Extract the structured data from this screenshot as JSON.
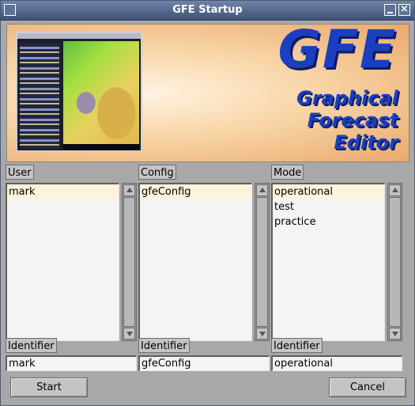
{
  "window": {
    "title": "GFE Startup",
    "icons": {
      "window": "window-icon",
      "minimize": "minimize-icon",
      "close": "close-icon"
    },
    "close_glyph": "×"
  },
  "banner": {
    "logo": "GFE",
    "subtitle_lines": [
      "Graphical",
      "Forecast",
      "Editor"
    ],
    "logo_color": "#1a3fc0"
  },
  "columns": [
    {
      "header": "User",
      "items": [
        "mark"
      ],
      "selected": 0,
      "identifier_label": "Identifier",
      "identifier_value": "mark"
    },
    {
      "header": "Config",
      "items": [
        "gfeConfig"
      ],
      "selected": 0,
      "identifier_label": "Identifier",
      "identifier_value": "gfeConfig"
    },
    {
      "header": "Mode",
      "items": [
        "operational",
        "test",
        "practice"
      ],
      "selected": 0,
      "identifier_label": "Identifier",
      "identifier_value": "operational"
    }
  ],
  "buttons": {
    "start": "Start",
    "cancel": "Cancel"
  }
}
